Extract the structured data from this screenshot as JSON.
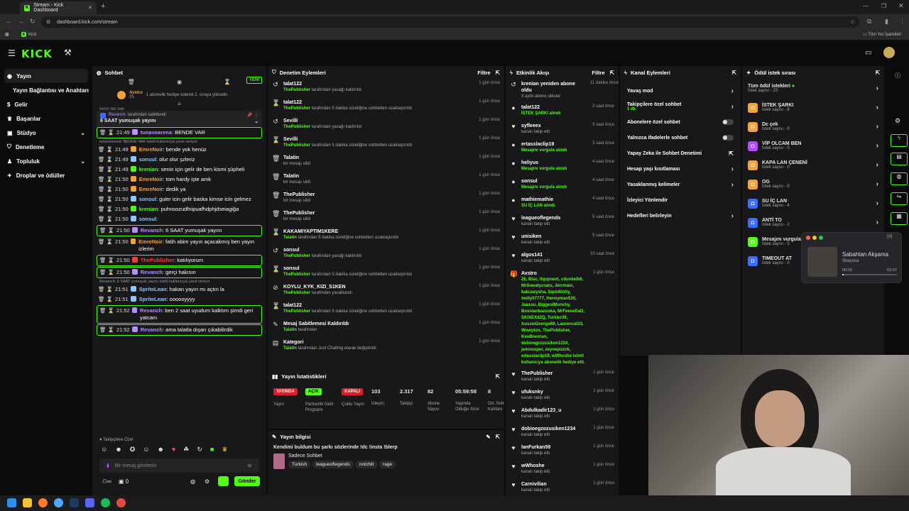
{
  "browser": {
    "tab_title": "Stream - Kick Dashboard",
    "url": "dashboard.kick.com/stream",
    "bookmark": "Kick",
    "all_bookmarks": "Tüm Yer İşaretleri"
  },
  "logo": "KICK",
  "sidebar": {
    "items": [
      {
        "label": "Yayın",
        "active": true
      },
      {
        "label": "Yayın Bağlantısı ve Anahtarı"
      },
      {
        "label": "Gelir"
      },
      {
        "label": "Başarılar"
      },
      {
        "label": "Stüdyo"
      },
      {
        "label": "Denetleme"
      },
      {
        "label": "Topluluk"
      },
      {
        "label": "Droplar ve ödüller"
      }
    ]
  },
  "chat": {
    "title": "Sohbet",
    "new_label": "YENİ",
    "gift": {
      "user": "Avstro",
      "count": "25",
      "text": "1 abonelik hediye ederek 2. sıraya yükselin"
    },
    "pinned": {
      "by": "Revanch",
      "suffix": "tarafından sabitlendi",
      "text": "6 SAAT yumuşak yayını"
    },
    "partial": "kesin bel bak",
    "messages": [
      {
        "time": "21:49",
        "user": "tunavearena",
        "color": "#c08cff",
        "text": "BENDE VAR",
        "hl": true
      },
      {
        "reply": "tunavearena: BENDE VAR isimli kullanıcıya yanıt veriyor"
      },
      {
        "time": "21:49",
        "user": "EmreNoir",
        "color": "#f2a23a",
        "text": "bende yok henüz"
      },
      {
        "time": "21:49",
        "user": "sonsul",
        "color": "#8fc4ff",
        "text": "olur olur şzleriz"
      },
      {
        "time": "21:49",
        "user": "krenian",
        "color": "#53fc18",
        "text": "senin için gelir de ben kismi şüpheli"
      },
      {
        "time": "21:50",
        "user": "EmreNoir",
        "color": "#f2a23a",
        "text": "tom hardy işte amk"
      },
      {
        "time": "21:50",
        "user": "EmreNoir",
        "color": "#f2a23a",
        "text": "dedik ya"
      },
      {
        "time": "21:50",
        "user": "sonsul",
        "color": "#8fc4ff",
        "text": "guler icin gelir baska kimse icin gelmez"
      },
      {
        "time": "21:50",
        "user": "krenian",
        "color": "#53fc18",
        "text": "puhnsozudfnipuafhdphjdseiagiğa"
      },
      {
        "time": "21:50",
        "user": "sonsul",
        "color": "#8fc4ff",
        "text": ""
      },
      {
        "time": "21:50",
        "user": "Revanch",
        "color": "#b98cff",
        "text": "6 SAAT yumuşak yayını",
        "hl": true
      },
      {
        "time": "21:50",
        "user": "EmreNoir",
        "color": "#f2a23a",
        "text": "fatih abim yayın açacakmış ben yayın izlerim"
      },
      {
        "time": "21:50",
        "user": "ThePublisher",
        "color": "#ff3b3b",
        "text": "katılıyorum",
        "hl": true
      },
      {
        "time": "21:50",
        "user": "Revanch",
        "color": "#b98cff",
        "text": "gerçi hakısın",
        "hl": true
      },
      {
        "reply": "Revanch: 6 SAAT yumuşak yayını isimli kullanıcıya yanıt veriyor"
      },
      {
        "time": "21:51",
        "user": "SpriteLean",
        "color": "#8fc4ff",
        "text": "hakan yayın mı açtın la"
      },
      {
        "time": "21:51",
        "user": "SpriteLean",
        "color": "#8fc4ff",
        "text": "oooooyyyy"
      },
      {
        "time": "21:52",
        "user": "Revanch",
        "color": "#b98cff",
        "text": "ben 2 saat uyudum kalktım şimdi geri yatcam",
        "hl": true
      },
      {
        "time": "21:52",
        "user": "Revanch",
        "color": "#b98cff",
        "text": "ama talatla dışarı çıkabilirdik",
        "hl": true
      }
    ],
    "followers_only": "Takipçilere Özel",
    "input_placeholder": "Bir mesaj gönderin",
    "send": "Gönder",
    "viewers": "0"
  },
  "moderation": {
    "title": "Denetim Eylemleri",
    "filter": "Filtre",
    "items": [
      {
        "icon": "↺",
        "name": "talat122",
        "by": "ThePublisher",
        "text": "tarafından yasağı kaldırıldı",
        "time": "1 gün önce"
      },
      {
        "icon": "⌛",
        "name": "talat122",
        "by": "ThePublisher",
        "text": "tarafından 5 dakika süreliğine sohbetten uzaklaştırıldı",
        "time": "1 gün önce"
      },
      {
        "icon": "↺",
        "name": "Sevilli",
        "by": "ThePublisher",
        "text": "tarafından yasağı kaldırıldı",
        "time": "1 gün önce"
      },
      {
        "icon": "⌛",
        "name": "Sevilli",
        "by": "ThePublisher",
        "text": "tarafından 5 dakika süreliğine sohbetten uzaklaştırıldı",
        "time": "1 gün önce"
      },
      {
        "icon": "🗑",
        "name": "Talatin",
        "by": "",
        "text": "bir mesajı sildi",
        "time": "1 gün önce"
      },
      {
        "icon": "🗑",
        "name": "Talatin",
        "by": "",
        "text": "bir mesajı sildi",
        "time": "1 gün önce"
      },
      {
        "icon": "🗑",
        "name": "ThePublisher",
        "by": "",
        "text": "bir mesajı sildi",
        "time": "1 gün önce"
      },
      {
        "icon": "🗑",
        "name": "ThePublisher",
        "by": "",
        "text": "bir mesajı sildi",
        "time": "1 gün önce"
      },
      {
        "icon": "⌛",
        "name": "KAKAMIYAPTIM1KERE",
        "by": "Talatin",
        "text": "tarafından 5 dakika süreliğine sohbetten uzaklaştırıldı",
        "time": "1 gün önce"
      },
      {
        "icon": "↺",
        "name": "sonsul",
        "by": "ThePublisher",
        "text": "tarafından yasağı kaldırıldı",
        "time": "1 gün önce"
      },
      {
        "icon": "⌛",
        "name": "sonsul",
        "by": "ThePublisher",
        "text": "tarafından 5 dakika süreliğine sohbetten uzaklaştırıldı",
        "time": "1 gün önce"
      },
      {
        "icon": "⊘",
        "name": "KOYLU_KYK_KIZI_S1KEN",
        "by": "ThePublisher",
        "text": "tarafından yasaklandı",
        "time": "1 gün önce"
      },
      {
        "icon": "⌛",
        "name": "talat122",
        "by": "ThePublisher",
        "text": "tarafından 5 dakika süreliğine sohbetten uzaklaştırıldı",
        "time": "1 gün önce"
      },
      {
        "icon": "✎",
        "name": "Mesaj Sabitlemesi Kaldırıldı",
        "by": "Talatin",
        "text": "tarafından",
        "time": "1 gün önce"
      },
      {
        "icon": "▤",
        "name": "Kategori",
        "by": "Talatin",
        "text": "tarafından Just Chatting olarak değiştirildi",
        "time": "1 gün önce"
      }
    ]
  },
  "stats": {
    "title": "Yayın İstatistikleri",
    "badges": [
      {
        "label": "YAYINDA",
        "color": "#e01b24"
      },
      {
        "label": "AÇIK",
        "color": "#53fc18"
      },
      {
        "label": "KAPALI",
        "color": "#e01b24"
      }
    ],
    "labels": [
      "Yayın",
      "Partnerlik Gelir Programı",
      "Çoklu Yayın"
    ],
    "values": [
      {
        "v": "103",
        "l": "İzleyici"
      },
      {
        "v": "2.317",
        "l": "Takipçi"
      },
      {
        "v": "82",
        "l": "Abone Sayısı"
      },
      {
        "v": "05:59:58",
        "l": "Yayında Olduğu Süre"
      },
      {
        "v": "8",
        "l": "Ort. Sohbet Katılanı"
      }
    ]
  },
  "info": {
    "title": "Yayın bilgisi",
    "stream_title": "Kendimi buldum bu şarkı sözlerinde !dc !insta !blerp",
    "category": "Sadece Sohbet",
    "tags": [
      "Turkish",
      "leagueoflegends",
      "notchill",
      "rage"
    ]
  },
  "activity": {
    "title": "Etkinlik Akışı",
    "filter": "Filtre",
    "items": [
      {
        "icon": "↺",
        "name": "krenian yeniden abone oldu",
        "sub": "3 aylık abone oldular",
        "time": "11 dakika önce"
      },
      {
        "icon": "●",
        "name": "talat122",
        "sub": "İSTEK ŞARKI alındı",
        "green": true,
        "time": "3 saat önce"
      },
      {
        "icon": "♥",
        "name": "syfleeex",
        "sub": "kanalı takip etti",
        "time": "3 saat önce"
      },
      {
        "icon": "●",
        "name": "ertasslaclip19",
        "sub": "Mesajını vurgula alındı",
        "green": true,
        "time": "3 saat önce"
      },
      {
        "icon": "●",
        "name": "heliyus",
        "sub": "Mesajını vurgula alındı",
        "green": true,
        "time": "4 saat önce"
      },
      {
        "icon": "●",
        "name": "sonsul",
        "sub": "Mesajını vurgula alındı",
        "green": true,
        "time": "4 saat önce"
      },
      {
        "icon": "●",
        "name": "mathiemathie",
        "sub": "SU İÇ LAN alındı",
        "green": true,
        "time": "4 saat önce"
      },
      {
        "icon": "♥",
        "name": "leagueoflegends",
        "sub": "kanalı takip etti",
        "time": "5 saat önce"
      },
      {
        "icon": "♥",
        "name": "unisiken",
        "sub": "kanalı takip etti",
        "time": "5 saat önce"
      },
      {
        "icon": "♥",
        "name": "algos141",
        "sub": "kanalı takip etti",
        "time": "10 saat önce"
      },
      {
        "icon": "🎁",
        "name": "Avstro",
        "sub": "25, Bisc, Ilqupnext, cdunkelb6, MrSweatycraks, Jerrmain, kakuseysha, Squidtinity, melly07777, Hennyman530, Jaassu, BiggestMunchy, Bosnianbazooka, MrFeeseDaD, SKIXEXd2Q, Turkler39, AussieGeorge89, Laurencat33, Wowykzx, ThePublisher, KenBrennan, dobioegzozusiken1234, jamnooper, zeynepozirk, ertassiaclip19, wWhoshe isimli kullanıcıya abonelik hediye etti.",
        "green": true,
        "time": "1 gün önce"
      },
      {
        "icon": "♥",
        "name": "ThePublisher",
        "sub": "kanalı takip etti",
        "time": "1 gün önce"
      },
      {
        "icon": "♥",
        "name": "ufuksnky",
        "sub": "kanalı takip etti",
        "time": "1 gün önce"
      },
      {
        "icon": "♥",
        "name": "Abdulkadir123_u",
        "sub": "kanalı takip etti",
        "time": "1 gün önce"
      },
      {
        "icon": "♥",
        "name": "dobioegzozusiken1234",
        "sub": "kanalı takip etti",
        "time": "1 gün önce"
      },
      {
        "icon": "♥",
        "name": "lanFurkan59",
        "sub": "kanalı takip etti",
        "time": "1 gün önce"
      },
      {
        "icon": "♥",
        "name": "wWhoshe",
        "sub": "kanalı takip etti",
        "time": "1 gün önce"
      },
      {
        "icon": "♥",
        "name": "Carnivilian",
        "sub": "kanalı takip etti",
        "time": "1 gün önce"
      }
    ]
  },
  "channel": {
    "title": "Kanal Eylemleri",
    "items": [
      {
        "label": "Yavaş mod",
        "type": "chev"
      },
      {
        "label": "Takipçilere özel sohbet",
        "sub": "1 dk.",
        "type": "chev"
      },
      {
        "label": "Abonelere özel sohbet",
        "type": "toggle"
      },
      {
        "label": "Yalnızca ifadelerle sohbet",
        "type": "toggle"
      },
      {
        "label": "Yapay Zeka ile Sohbet Denetimi",
        "type": "ext"
      },
      {
        "label": "Hesap yaşı kısıtlaması",
        "type": "chev"
      },
      {
        "label": "Yasaklanmış kelimeler",
        "type": "chev"
      },
      {
        "label": "İzleyici Yönlendir",
        "type": "none"
      },
      {
        "label": "Hedefleri belirleyin",
        "type": "chev"
      }
    ]
  },
  "rewards": {
    "title": "Ödül istek sırası",
    "all": {
      "label": "Tüm ödül istekleri",
      "sub": "İstek sayısı - 23"
    },
    "items": [
      {
        "label": "İSTEK ŞARKI",
        "sub": "İstek sayısı - 6",
        "color": "#f2a23a"
      },
      {
        "label": "Dc çek",
        "sub": "İstek sayısı - 0",
        "color": "#f2a23a"
      },
      {
        "label": "VİP OLCAM BEN",
        "sub": "İstek sayısı - 0",
        "color": "#b04cff"
      },
      {
        "label": "KAPA LAN ÇENENİ",
        "sub": "İstek sayısı - 0",
        "color": "#f2a23a"
      },
      {
        "label": "OG",
        "sub": "İstek sayısı - 0",
        "color": "#f2a23a"
      },
      {
        "label": "SU İÇ LAN",
        "sub": "İstek sayısı - 4",
        "color": "#3b6bff"
      },
      {
        "label": "ANTİ TO",
        "sub": "İstek sayısı - 2",
        "color": "#3b6bff"
      },
      {
        "label": "Mesajını vurgula",
        "sub": "İstek sayısı - 5",
        "color": "#53fc18"
      },
      {
        "label": "TIMEOUT AT",
        "sub": "İstek sayısı - 0",
        "color": "#3b6bff"
      }
    ]
  },
  "player": {
    "title": "Sabahtan Akşama",
    "artist": "Skapova",
    "elapsed": "00:03",
    "total": "03:37"
  }
}
